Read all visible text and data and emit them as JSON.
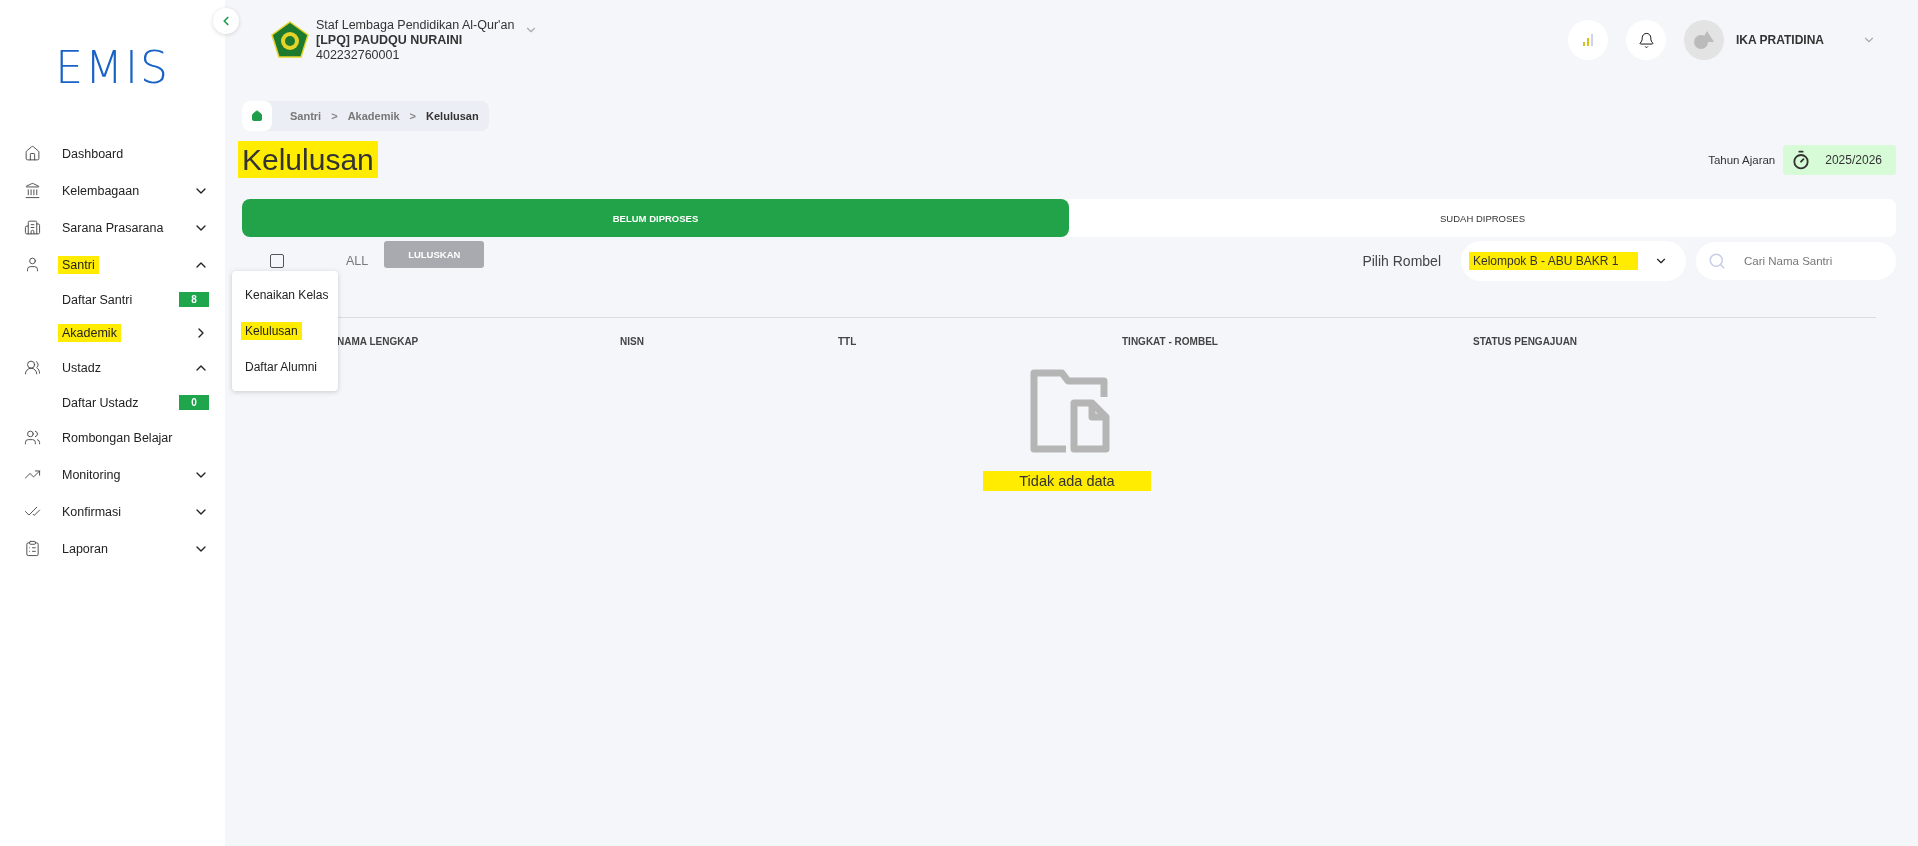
{
  "sidebar": {
    "logo": "EMIS",
    "items": [
      {
        "label": "Dashboard",
        "kind": "link",
        "highlighted": false
      },
      {
        "label": "Kelembagaan",
        "kind": "group",
        "expanded": false,
        "highlighted": false
      },
      {
        "label": "Sarana Prasarana",
        "kind": "group",
        "expanded": false,
        "highlighted": false
      },
      {
        "label": "Santri",
        "kind": "group",
        "expanded": true,
        "highlighted": true,
        "children": [
          {
            "label": "Daftar Santri",
            "kind": "count",
            "badge": "8",
            "highlighted": false
          },
          {
            "label": "Akademik",
            "kind": "submenu",
            "highlighted": true
          }
        ]
      },
      {
        "label": "Ustadz",
        "kind": "group",
        "expanded": true,
        "highlighted": false,
        "children": [
          {
            "label": "Daftar Ustadz",
            "kind": "count",
            "badge": "0",
            "highlighted": false
          }
        ]
      },
      {
        "label": "Rombongan Belajar",
        "kind": "link",
        "highlighted": false
      },
      {
        "label": "Monitoring",
        "kind": "group",
        "expanded": false,
        "highlighted": false
      },
      {
        "label": "Konfirmasi",
        "kind": "group",
        "expanded": false,
        "highlighted": false
      },
      {
        "label": "Laporan",
        "kind": "group",
        "expanded": false,
        "highlighted": false
      }
    ]
  },
  "submenu": [
    {
      "label": "Kenaikan Kelas",
      "highlighted": false
    },
    {
      "label": "Kelulusan",
      "highlighted": true
    },
    {
      "label": "Daftar Alumni",
      "highlighted": false
    }
  ],
  "header": {
    "role": "Staf Lembaga Pendidikan Al-Qur'an",
    "institution": "[LPQ] PAUDQU NURAINI",
    "code": "402232760001",
    "user": "IKA PRATIDINA"
  },
  "breadcrumb": {
    "separator": ">",
    "items": [
      "Santri",
      "Akademik",
      "Kelulusan"
    ]
  },
  "page": {
    "title": "Kelulusan",
    "title_highlighted": true,
    "year_label": "Tahun Ajaran",
    "year": "2025/2026"
  },
  "tabs": [
    {
      "label": "BELUM DIPROSES",
      "selected": true
    },
    {
      "label": "SUDAH DIPROSES",
      "selected": false
    }
  ],
  "toolbar": {
    "select_all": "ALL",
    "checked": false,
    "action": "LULUSKAN",
    "action_disabled": true,
    "rombel_label": "Pilih Rombel",
    "rombel": "Kelompok B - ABU BAKR 1",
    "rombel_highlighted": true,
    "search_placeholder": "Cari Nama Santri"
  },
  "table": {
    "columns": [
      "NAMA LENGKAP",
      "NISN",
      "TTL",
      "TINGKAT - ROMBEL",
      "STATUS PENGAJUAN"
    ],
    "empty": "Tidak ada data",
    "empty_highlighted": true
  }
}
